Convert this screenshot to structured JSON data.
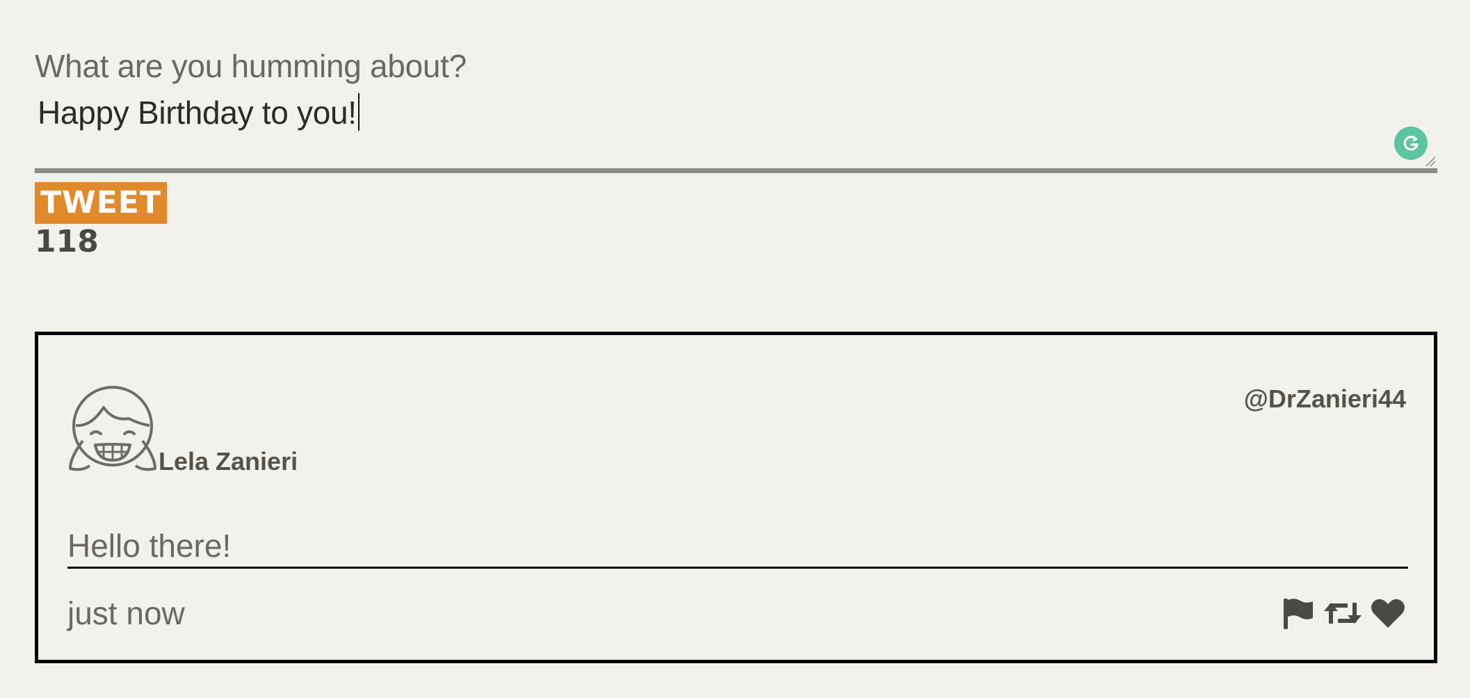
{
  "composer": {
    "label": "What are you humming about?",
    "value": "Happy Birthday to you!",
    "grammarly_icon": "grammarly-g-icon",
    "tweet_button_label": "TWEET",
    "char_count": "118",
    "accent_color": "#e08a2c"
  },
  "tweet": {
    "avatar_icon": "smiling-girl-avatar-icon",
    "display_name": "Lela Zanieri",
    "handle": "@DrZanieri44",
    "text": "Hello there!",
    "timestamp": "just now",
    "actions": {
      "flag_icon": "flag-icon",
      "retweet_icon": "retweet-icon",
      "like_icon": "heart-icon"
    }
  },
  "colors": {
    "background": "#f2f1ec",
    "text": "#55524b",
    "grammarly": "#5bc4a0"
  }
}
